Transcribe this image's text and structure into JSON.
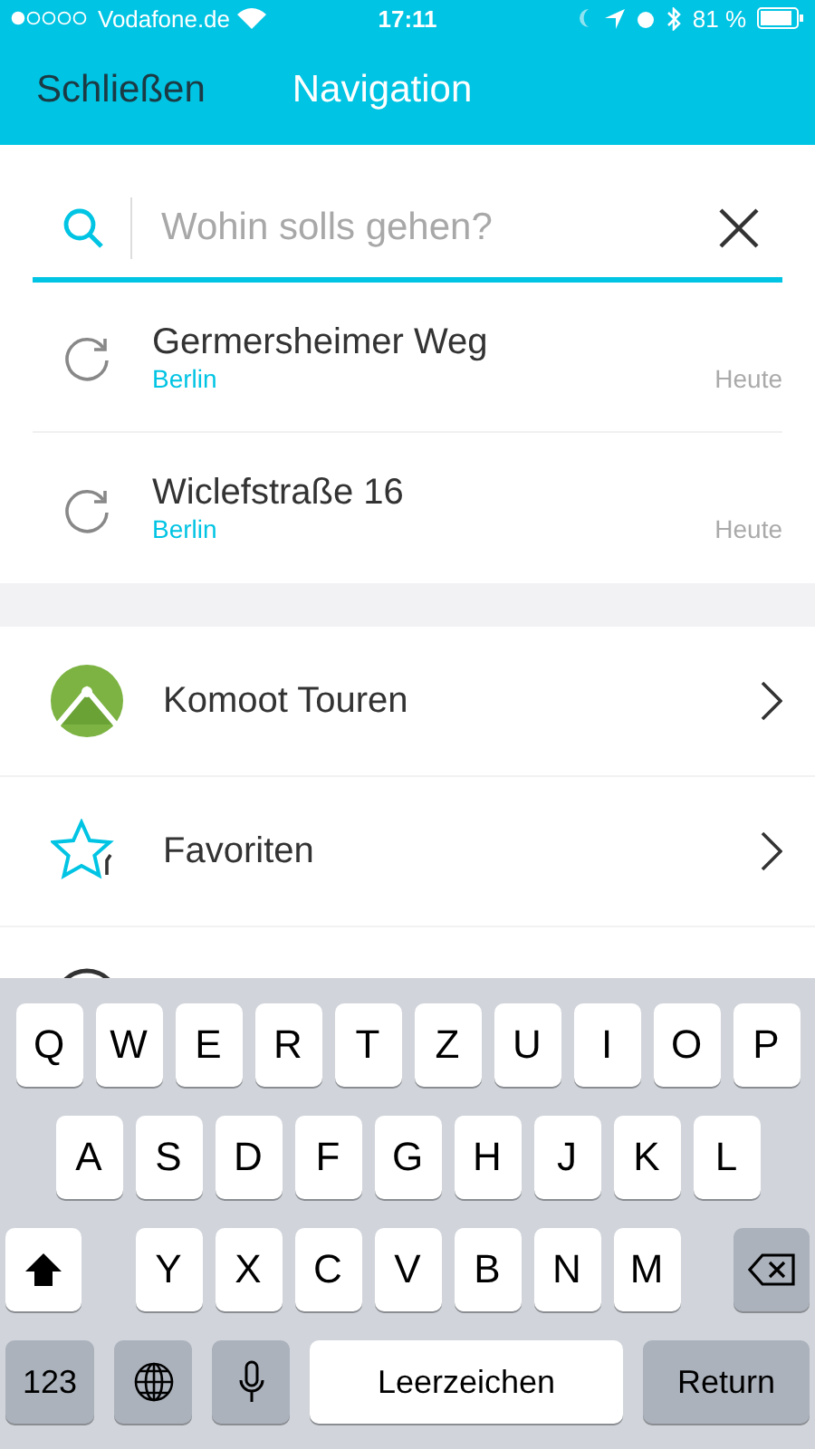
{
  "status_bar": {
    "carrier": "Vodafone.de",
    "time": "17:11",
    "battery": "81 %"
  },
  "nav": {
    "close": "Schließen",
    "title": "Navigation"
  },
  "search": {
    "placeholder": "Wohin solls gehen?"
  },
  "recent": [
    {
      "name": "Germersheimer Weg",
      "city": "Berlin",
      "when": "Heute"
    },
    {
      "name": "Wiclefstraße 16",
      "city": "Berlin",
      "when": "Heute"
    }
  ],
  "menu": [
    {
      "kind": "komoot",
      "label": "Komoot Touren"
    },
    {
      "kind": "star",
      "label": "Favoriten"
    },
    {
      "kind": "partial"
    }
  ],
  "keyboard": {
    "rows": [
      [
        "Q",
        "W",
        "E",
        "R",
        "T",
        "Z",
        "U",
        "I",
        "O",
        "P"
      ],
      [
        "A",
        "S",
        "D",
        "F",
        "G",
        "H",
        "J",
        "K",
        "L"
      ],
      [
        "Y",
        "X",
        "C",
        "V",
        "B",
        "N",
        "M"
      ]
    ],
    "numbers": "123",
    "space": "Leerzeichen",
    "return": "Return"
  }
}
